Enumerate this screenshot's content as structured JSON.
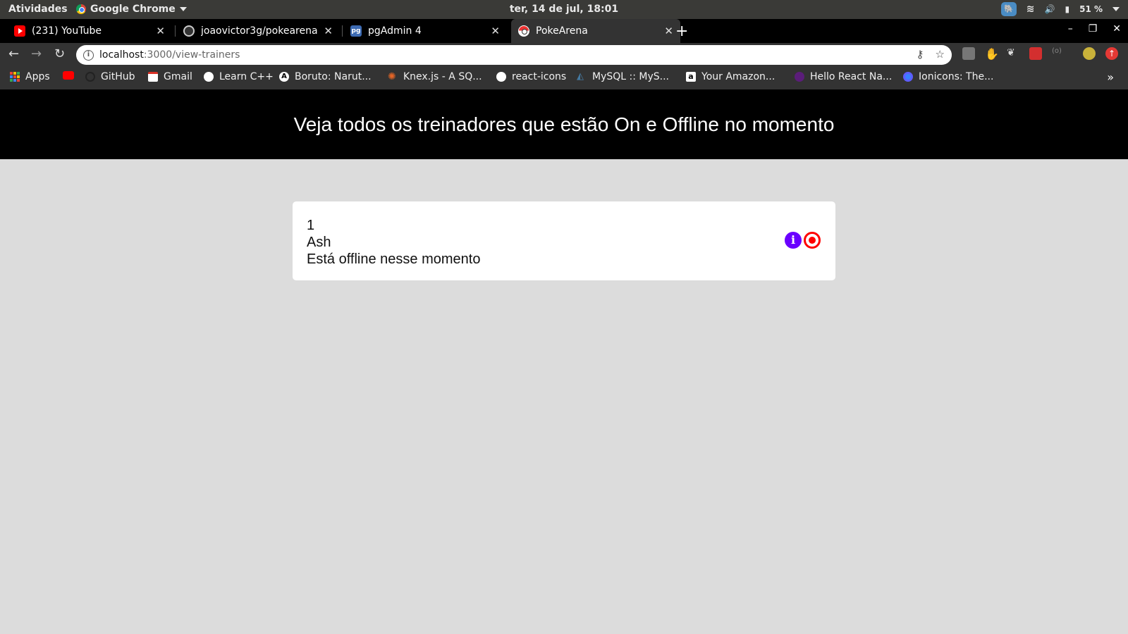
{
  "system_bar": {
    "activities": "Atividades",
    "app_name": "Google Chrome",
    "clock": "ter, 14 de jul, 18:01",
    "battery": "51 %"
  },
  "tabs": [
    {
      "title": "(231) YouTube",
      "favicon": "youtube-icon"
    },
    {
      "title": "joaovictor3g/pokearena",
      "favicon": "github-icon"
    },
    {
      "title": "pgAdmin 4",
      "favicon": "pgadmin-icon",
      "favicon_text": "pg"
    },
    {
      "title": "PokeArena",
      "favicon": "pokeball-icon",
      "active": true
    }
  ],
  "address_bar": {
    "host": "localhost",
    "path": ":3000/view-trainers"
  },
  "bookmarks": [
    {
      "label": "Apps",
      "icon": "apps-grid-icon"
    },
    {
      "label": "",
      "icon": "youtube-icon"
    },
    {
      "label": "GitHub",
      "icon": "github-icon"
    },
    {
      "label": "Gmail",
      "icon": "gmail-icon"
    },
    {
      "label": "Learn C++",
      "icon": "globe-icon"
    },
    {
      "label": "Boruto: Narut...",
      "icon": "anime-icon"
    },
    {
      "label": "Knex.js - A SQ...",
      "icon": "knex-icon"
    },
    {
      "label": "react-icons",
      "icon": "globe-icon"
    },
    {
      "label": "MySQL :: MyS...",
      "icon": "mysql-icon"
    },
    {
      "label": "Your Amazon...",
      "icon": "amazon-icon"
    },
    {
      "label": "Hello React Na...",
      "icon": "react-native-icon"
    },
    {
      "label": "Ionicons: The...",
      "icon": "ionicons-icon"
    }
  ],
  "page": {
    "header_title": "Veja todos os treinadores que estão On e Offline no momento",
    "trainers": [
      {
        "id": "1",
        "name": "Ash",
        "status_text": "Está offline nesse momento"
      }
    ]
  },
  "colors": {
    "page_bg": "#dcdcdc",
    "header_bg": "#000000",
    "info_button": "#6a00ff",
    "offline_status": "#ff0000"
  }
}
